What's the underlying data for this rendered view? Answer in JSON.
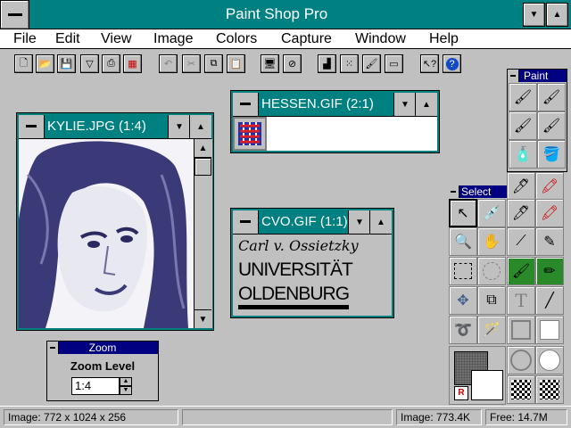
{
  "app": {
    "title": "Paint Shop Pro"
  },
  "menu": [
    "File",
    "Edit",
    "View",
    "Image",
    "Colors",
    "Capture",
    "Window",
    "Help"
  ],
  "toolbar": {
    "icons": [
      "new-icon",
      "open-icon",
      "save-icon",
      "filter-icon",
      "print-icon",
      "palette-icon",
      "undo-icon",
      "cut-icon",
      "copy-icon",
      "paste-icon",
      "capture-icon",
      "no-capture-icon",
      "histogram-icon",
      "grid-icon",
      "paint-icon",
      "toolbar-icon",
      "help-pointer-icon",
      "help-icon"
    ]
  },
  "windows": {
    "kylie": {
      "title": "KYLIE.JPG (1:4)"
    },
    "hessen": {
      "title": "HESSEN.GIF (2:1)"
    },
    "cvo": {
      "title": "CVO.GIF (1:1)",
      "signature": "Carl v. Ossietzky",
      "line1": "UNIVERSITÄT",
      "line2": "OLDENBURG"
    }
  },
  "zoom": {
    "title": "Zoom",
    "label": "Zoom Level",
    "value": "1:4"
  },
  "paint_palette": {
    "title": "Paint"
  },
  "select_palette": {
    "title": "Select"
  },
  "status": {
    "image_dims": "Image: 772 x 1024 x 256",
    "image_size": "Image: 773.4K",
    "free": "Free: 14.7M"
  },
  "colors": {
    "accent": "#008080",
    "palette_title": "#000080"
  }
}
